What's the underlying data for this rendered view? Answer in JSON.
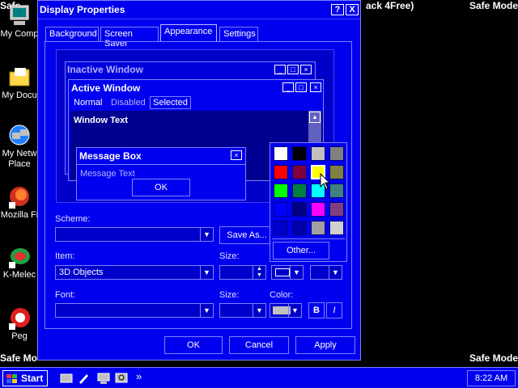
{
  "desktop": {
    "safe_mode": "Safe Mode",
    "safe_mode_left_top": "Safe",
    "safe_mode_left_bottom": "Safe Mo",
    "title_fragment": "ack 4Free)",
    "icons": [
      {
        "label": "My Comp",
        "icon": "computer-icon"
      },
      {
        "label": "My Docu",
        "icon": "folder-icon"
      },
      {
        "label": "My Netw",
        "label2": "Place",
        "icon": "network-icon"
      },
      {
        "label": "Mozilla Fi",
        "icon": "firefox-icon"
      },
      {
        "label": "K-Melec",
        "icon": "media-player-icon"
      },
      {
        "label": "Peg",
        "icon": "app-icon"
      }
    ]
  },
  "dialog": {
    "title": "Display Properties",
    "help_btn": "?",
    "close_btn": "X",
    "tabs": [
      "Background",
      "Screen Saver",
      "Appearance",
      "Settings"
    ],
    "preview": {
      "inactive_title": "Inactive Window",
      "active_title": "Active Window",
      "menu": [
        "Normal",
        "Disabled",
        "Selected"
      ],
      "window_text": "Window Text",
      "message_box_title": "Message Box",
      "message_text": "Message Text",
      "ok": "OK"
    },
    "scheme_label": "Scheme:",
    "scheme_value": "",
    "save_as": "Save As...",
    "item_label": "Item:",
    "item_value": "3D Objects",
    "size_label": "Size:",
    "size_label2": "Size:",
    "font_label": "Font:",
    "color_label": "Color:",
    "bold_btn": "B",
    "italic_btn": "I",
    "buttons": {
      "ok": "OK",
      "cancel": "Cancel",
      "apply": "Apply"
    }
  },
  "palette": {
    "other": "Other...",
    "colors": [
      [
        "#ffffff",
        "#000000",
        "#c0c0c0",
        "#808080"
      ],
      [
        "#ff0000",
        "#800040",
        "#ffff00",
        "#808040"
      ],
      [
        "#00ff00",
        "#008040",
        "#00ffff",
        "#408080"
      ],
      [
        "#0000ff",
        "#000080",
        "#ff00ff",
        "#804080"
      ],
      [
        "#0000cc",
        "#0000aa",
        "#a0a0a0",
        "#d0d0d0"
      ]
    ]
  },
  "taskbar": {
    "start": "Start",
    "clock": "8:22 AM",
    "more": "»"
  }
}
